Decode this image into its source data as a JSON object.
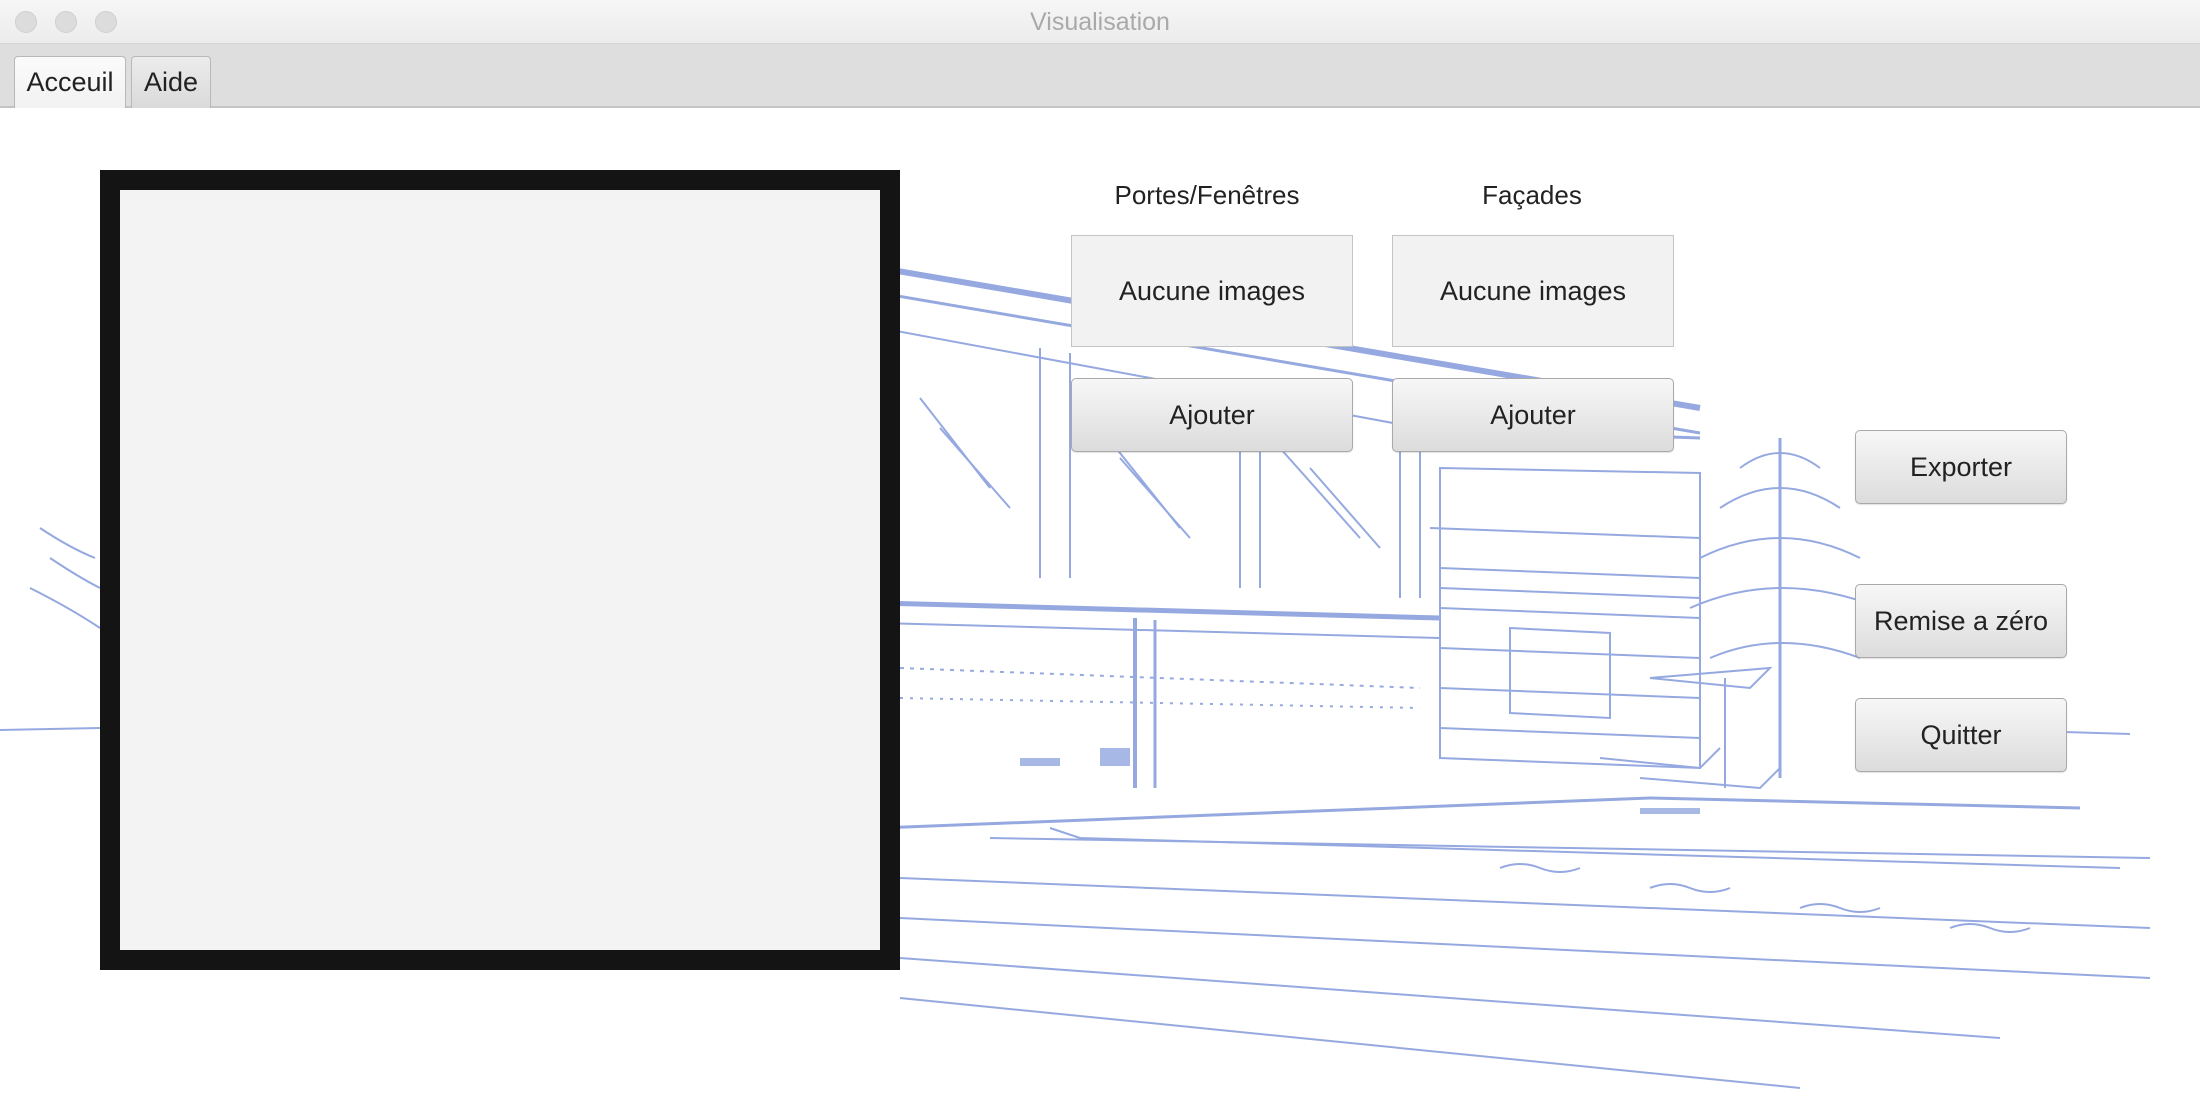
{
  "window": {
    "title": "Visualisation"
  },
  "tabs": [
    {
      "label": "Acceuil",
      "active": true
    },
    {
      "label": "Aide",
      "active": false
    }
  ],
  "panels": {
    "portes_fenetres": {
      "label": "Portes/Fenêtres",
      "image_status": "Aucune images",
      "add_button": "Ajouter"
    },
    "facades": {
      "label": "Façades",
      "image_status": "Aucune images",
      "add_button": "Ajouter"
    }
  },
  "actions": {
    "export": "Exporter",
    "reset": "Remise a zéro",
    "quit": "Quitter"
  },
  "colors": {
    "sketch_blue": "#3f63c8",
    "frame_border": "#141414",
    "preview_fill": "#f3f3f3"
  }
}
